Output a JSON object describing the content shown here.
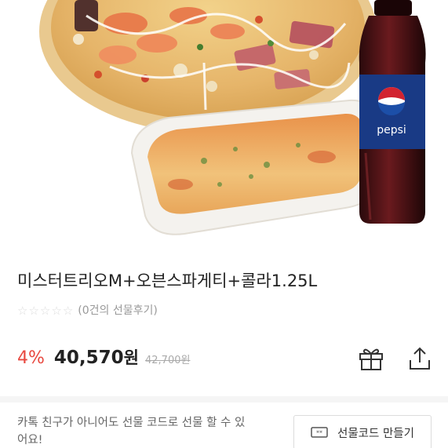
{
  "product": {
    "title": "미스터트리오M+오븐스파게티+콜라1.25L",
    "bottle_label": "pepsi"
  },
  "rating": {
    "stars": [
      "☆",
      "☆",
      "☆",
      "☆",
      "☆"
    ],
    "filled_stars": 0,
    "review_text": "(0건의 선물후기)"
  },
  "price": {
    "discount": "4%",
    "amount": "40,570",
    "currency": "원",
    "original": "42,700원"
  },
  "actions": {
    "gift_icon": "gift-icon",
    "share_icon": "share-icon"
  },
  "gift_code": {
    "description": "카톡 친구가 아니어도 선물 코드로 선물 할 수 있어요!",
    "button_label": "선물코드 만들기",
    "button_icon": "ticket-icon"
  },
  "colors": {
    "discount": "#e8483f",
    "pepsi_blue": "#1c3f94"
  }
}
